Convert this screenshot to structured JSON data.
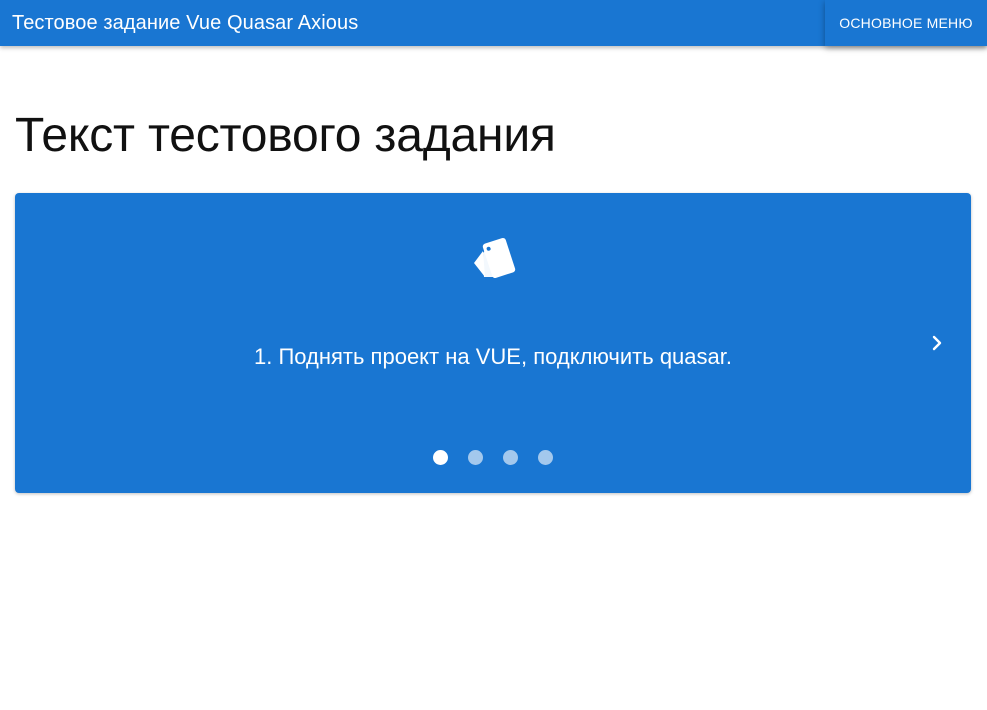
{
  "header": {
    "title": "Тестовое задание Vue Quasar Axious",
    "menu_button_label": "ОСНОВНОЕ МЕНЮ"
  },
  "main": {
    "page_title": "Текст тестового задания",
    "carousel": {
      "icon": "cards-icon",
      "slide_text": "1. Поднять проект на VUE, подключить quasar.",
      "slide_count": 4,
      "active_slide": 1,
      "next_icon": "chevron-right-icon"
    }
  },
  "colors": {
    "primary": "#1976d2",
    "text_on_primary": "#ffffff",
    "heading_text": "#111111"
  }
}
